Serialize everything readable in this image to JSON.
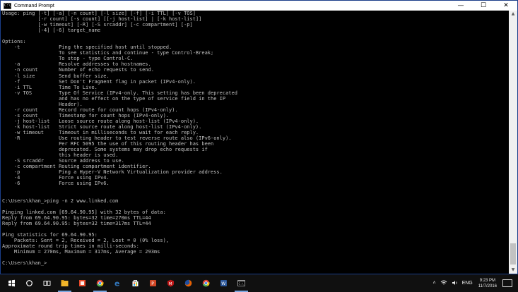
{
  "window": {
    "title": "Command Prompt",
    "icon_label": "C:\\",
    "controls": {
      "minimize": "—",
      "maximize": "☐",
      "close": "✕"
    }
  },
  "console_lines": [
    "Usage: ping [-t] [-a] [-n count] [-l size] [-f] [-i TTL] [-v TOS]",
    "            [-r count] [-s count] [[-j host-list] | [-k host-list]]",
    "            [-w timeout] [-R] [-S srcaddr] [-c compartment] [-p]",
    "            [-4] [-6] target_name",
    "",
    "Options:",
    "    -t             Ping the specified host until stopped.",
    "                   To see statistics and continue - type Control-Break;",
    "                   To stop - type Control-C.",
    "    -a             Resolve addresses to hostnames.",
    "    -n count       Number of echo requests to send.",
    "    -l size        Send buffer size.",
    "    -f             Set Don't Fragment flag in packet (IPv4-only).",
    "    -i TTL         Time To Live.",
    "    -v TOS         Type Of Service (IPv4-only. This setting has been deprecated",
    "                   and has no effect on the type of service field in the IP",
    "                   Header).",
    "    -r count       Record route for count hops (IPv4-only).",
    "    -s count       Timestamp for count hops (IPv4-only).",
    "    -j host-list   Loose source route along host-list (IPv4-only).",
    "    -k host-list   Strict source route along host-list (IPv4-only).",
    "    -w timeout     Timeout in milliseconds to wait for each reply.",
    "    -R             Use routing header to test reverse route also (IPv6-only).",
    "                   Per RFC 5095 the use of this routing header has been",
    "                   deprecated. Some systems may drop echo requests if",
    "                   this header is used.",
    "    -S srcaddr     Source address to use.",
    "    -c compartment Routing compartment identifier.",
    "    -p             Ping a Hyper-V Network Virtualization provider address.",
    "    -4             Force using IPv4.",
    "    -6             Force using IPv6.",
    "",
    "",
    "C:\\Users\\khan_>ping -n 2 www.linked.com",
    "",
    "Pinging linked.com [69.64.90.95] with 32 bytes of data:",
    "Reply from 69.64.90.95: bytes=32 time=270ms TTL=44",
    "Reply from 69.64.90.95: bytes=32 time=317ms TTL=44",
    "",
    "Ping statistics for 69.64.90.95:",
    "    Packets: Sent = 2, Received = 2, Lost = 0 (0% loss),",
    "Approximate round trip times in milli-seconds:",
    "    Minimum = 270ms, Maximum = 317ms, Average = 293ms",
    "",
    "C:\\Users\\khan_>"
  ],
  "scrollbar": {
    "up_arrow": "▲",
    "down_arrow": "▼"
  },
  "taskbar": {
    "apps": [
      {
        "name": "start-icon",
        "color": "#ffffff"
      },
      {
        "name": "cortana-icon",
        "color": "#ffffff"
      },
      {
        "name": "task-view-icon",
        "color": "#ffffff"
      },
      {
        "name": "file-explorer-icon",
        "color": "#f0b429"
      },
      {
        "name": "office-icon",
        "color": "#e8492a"
      },
      {
        "name": "chrome-icon",
        "color": "#4caf50"
      },
      {
        "name": "edge-icon",
        "color": "#3277bc"
      },
      {
        "name": "store-icon",
        "color": "#ffffff"
      },
      {
        "name": "powerpoint-icon",
        "color": "#d24726"
      },
      {
        "name": "mcafee-icon",
        "color": "#c01818"
      },
      {
        "name": "firefox-icon",
        "color": "#e66000"
      },
      {
        "name": "chrome-alt-icon",
        "color": "#4caf50"
      },
      {
        "name": "word-icon",
        "color": "#2b579a"
      },
      {
        "name": "cmd-icon",
        "color": "#9a9a9a"
      }
    ],
    "tray": {
      "chevron": "˄",
      "language": "ENG",
      "time": "9:23 PM",
      "date": "11/7/2016"
    }
  }
}
